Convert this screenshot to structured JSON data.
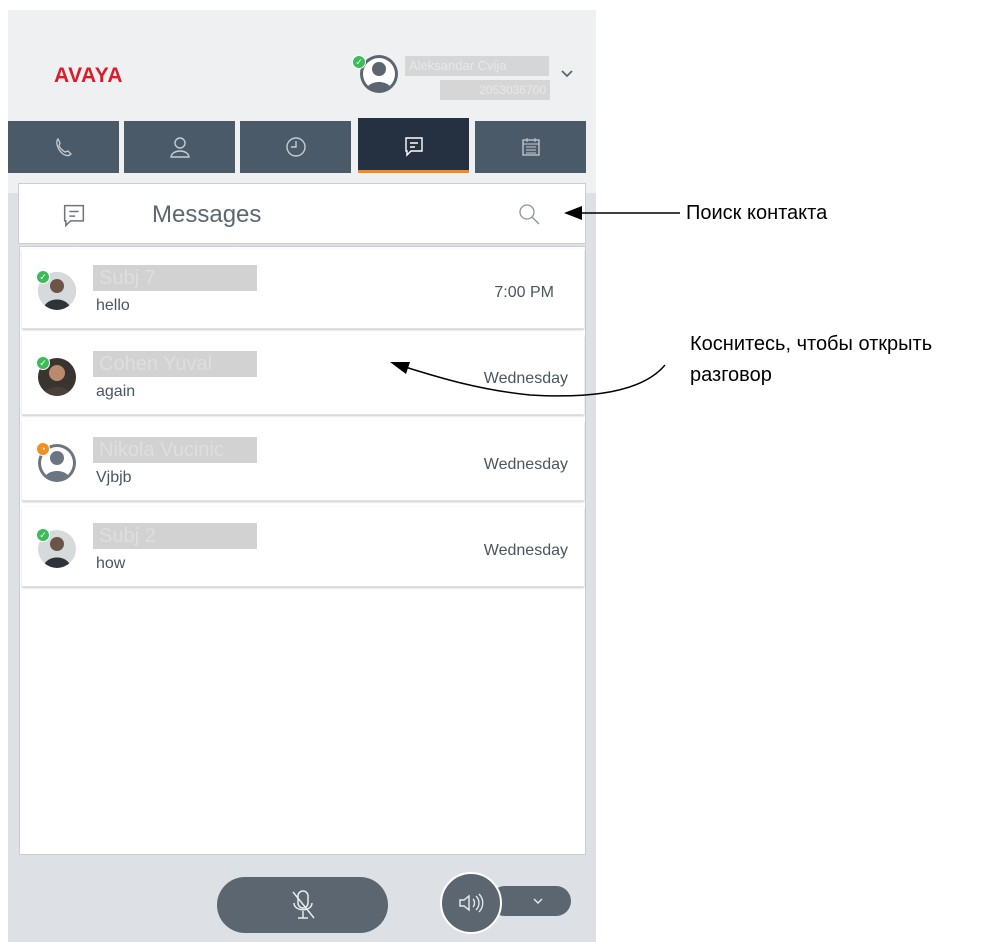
{
  "app": {
    "logo": "AVAYA",
    "user": {
      "name": "Aleksandar Cvija",
      "extension": "2053036700"
    },
    "tabs": [
      {
        "icon": "phone-icon"
      },
      {
        "icon": "contacts-icon"
      },
      {
        "icon": "history-icon"
      },
      {
        "icon": "messages-icon",
        "active": true
      },
      {
        "icon": "calendar-icon"
      }
    ]
  },
  "messages": {
    "title": "Messages",
    "search_icon": "search-icon",
    "conversations": [
      {
        "name": "Subj 7",
        "preview": "hello",
        "time": "7:00 PM",
        "presence": "available"
      },
      {
        "name": "Cohen Yuval",
        "preview": "again",
        "time": "Wednesday",
        "presence": "available"
      },
      {
        "name": "Nikola Vucinic",
        "preview": "Vjbjb",
        "time": "Wednesday",
        "presence": "away"
      },
      {
        "name": "Subj 2",
        "preview": "how",
        "time": "Wednesday",
        "presence": "available"
      }
    ]
  },
  "footer": {
    "mute_icon": "mic-off-icon",
    "speaker_icon": "speaker-icon",
    "chevron_icon": "chevron-down-icon"
  },
  "annotations": {
    "search": "Поиск контакта",
    "open_line1": "Коснитесь, чтобы открыть",
    "open_line2": "разговор"
  },
  "colors": {
    "brand": "#d81e2a",
    "tab": "#4b5a68",
    "tab_active": "#253140",
    "accent": "#f38a1b",
    "available": "#3dbb5a",
    "away": "#f0901e"
  }
}
